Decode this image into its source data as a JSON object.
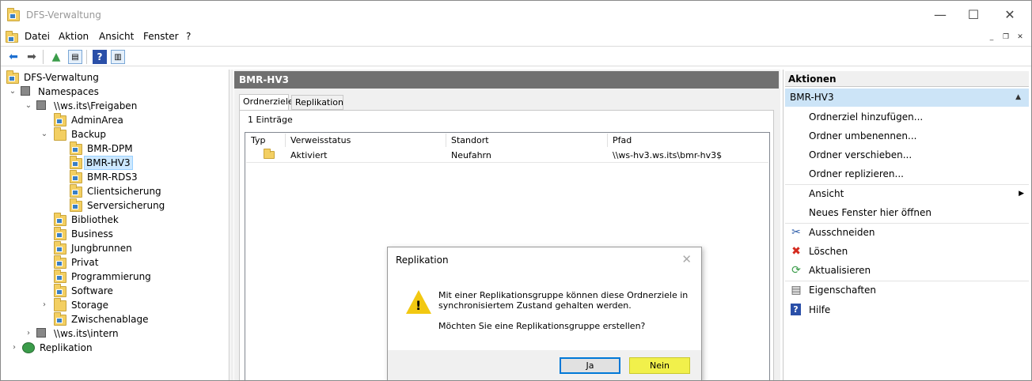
{
  "window": {
    "title": "DFS-Verwaltung",
    "controls": {
      "minimize": "—",
      "maximize": "☐",
      "close": "✕"
    }
  },
  "menu": {
    "items": [
      "Datei",
      "Aktion",
      "Ansicht",
      "Fenster",
      "?"
    ],
    "mdi_controls": {
      "minimize": "_",
      "restore": "❐",
      "close": "✕"
    }
  },
  "tree": {
    "root": "DFS-Verwaltung",
    "namespaces": "Namespaces",
    "freigaben": "\\\\ws.its\\Freigaben",
    "adminarea": "AdminArea",
    "backup": "Backup",
    "bmr_dpm": "BMR-DPM",
    "bmr_hv3": "BMR-HV3",
    "bmr_rds3": "BMR-RDS3",
    "clientsicherung": "Clientsicherung",
    "serversicherung": "Serversicherung",
    "bibliothek": "Bibliothek",
    "business": "Business",
    "jungbrunnen": "Jungbrunnen",
    "privat": "Privat",
    "programmierung": "Programmierung",
    "software": "Software",
    "storage": "Storage",
    "zwischenablage": "Zwischenablage",
    "intern": "\\\\ws.its\\intern",
    "replikation": "Replikation"
  },
  "center": {
    "header": "BMR-HV3",
    "tabs": [
      "Ordnerziele",
      "Replikation"
    ],
    "count": "1 Einträge",
    "columns": [
      "Typ",
      "Verweisstatus",
      "Standort",
      "Pfad"
    ],
    "rows": [
      {
        "status": "Aktiviert",
        "standort": "Neufahrn",
        "pfad": "\\\\ws-hv3.ws.its\\bmr-hv3$"
      }
    ]
  },
  "actions": {
    "header": "Aktionen",
    "section": "BMR-HV3",
    "items": {
      "add_target": "Ordnerziel hinzufügen...",
      "rename": "Ordner umbenennen...",
      "move": "Ordner verschieben...",
      "replicate": "Ordner replizieren...",
      "view": "Ansicht",
      "new_window": "Neues Fenster hier öffnen",
      "cut": "Ausschneiden",
      "delete": "Löschen",
      "refresh": "Aktualisieren",
      "properties": "Eigenschaften",
      "help": "Hilfe"
    }
  },
  "dialog": {
    "title": "Replikation",
    "message": "Mit einer Replikationsgruppe können diese Ordnerziele in synchronisiertem Zustand gehalten werden.",
    "question": "Möchten Sie eine Replikationsgruppe erstellen?",
    "yes": "Ja",
    "no": "Nein",
    "highlight_color": "#f1f04b"
  }
}
